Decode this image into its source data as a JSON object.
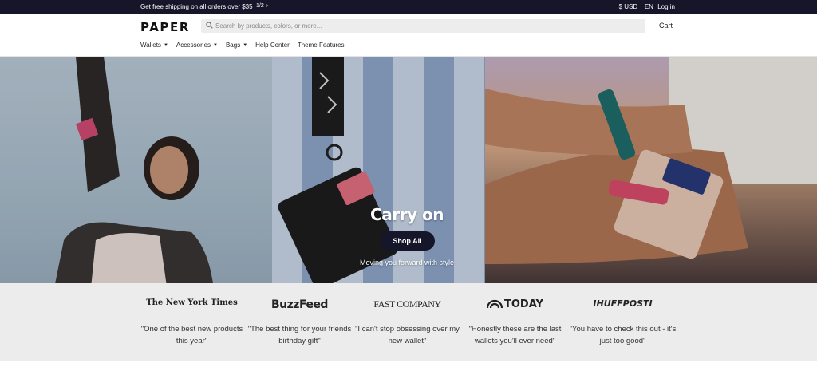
{
  "announcement": {
    "text_before": "Get free",
    "link": "shipping",
    "text_after": "on all orders over $35",
    "pager": "1/2",
    "currency": "$ USD",
    "separator": "·",
    "language": "EN",
    "login": "Log in"
  },
  "header": {
    "logo": "PAPER",
    "search_placeholder": "Search by products, colors, or more...",
    "cart": "Cart"
  },
  "nav": [
    {
      "label": "Wallets",
      "dropdown": true
    },
    {
      "label": "Accessories",
      "dropdown": true
    },
    {
      "label": "Bags",
      "dropdown": true
    },
    {
      "label": "Help Center",
      "dropdown": false
    },
    {
      "label": "Theme Features",
      "dropdown": false
    }
  ],
  "hero": {
    "title": "Carry on",
    "button": "Shop All",
    "subtitle": "Moving you forward with style"
  },
  "press": [
    {
      "outlet": "The New York Times",
      "quote": "\"One of the best new products this year\""
    },
    {
      "outlet": "BuzzFeed",
      "quote": "\"The best thing for your friends birthday gift\""
    },
    {
      "outlet": "FAST COMPANY",
      "quote": "\"I can't stop obsessing over my new wallet\""
    },
    {
      "outlet": "TODAY",
      "quote": "\"Honestly these are the last wallets you'll ever need\""
    },
    {
      "outlet": "IHUFFPOSTI",
      "quote": "\"You have to check this out - it's just too good\""
    }
  ],
  "colors": {
    "topbar": "#16162a",
    "button": "#16162a",
    "press_bg": "#ececec"
  }
}
